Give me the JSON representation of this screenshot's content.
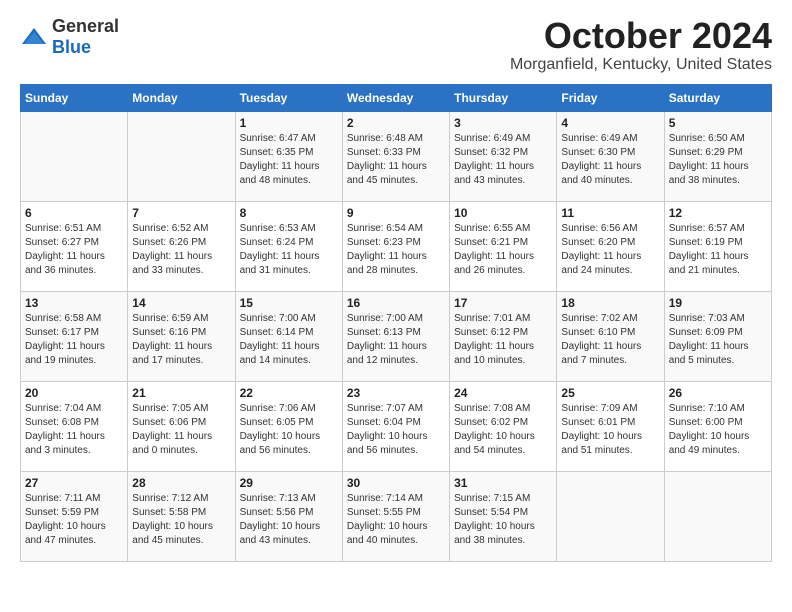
{
  "header": {
    "logo_general": "General",
    "logo_blue": "Blue",
    "month_year": "October 2024",
    "location": "Morganfield, Kentucky, United States"
  },
  "days_of_week": [
    "Sunday",
    "Monday",
    "Tuesday",
    "Wednesday",
    "Thursday",
    "Friday",
    "Saturday"
  ],
  "weeks": [
    [
      {
        "day": "",
        "content": ""
      },
      {
        "day": "",
        "content": ""
      },
      {
        "day": "1",
        "content": "Sunrise: 6:47 AM\nSunset: 6:35 PM\nDaylight: 11 hours and 48 minutes."
      },
      {
        "day": "2",
        "content": "Sunrise: 6:48 AM\nSunset: 6:33 PM\nDaylight: 11 hours and 45 minutes."
      },
      {
        "day": "3",
        "content": "Sunrise: 6:49 AM\nSunset: 6:32 PM\nDaylight: 11 hours and 43 minutes."
      },
      {
        "day": "4",
        "content": "Sunrise: 6:49 AM\nSunset: 6:30 PM\nDaylight: 11 hours and 40 minutes."
      },
      {
        "day": "5",
        "content": "Sunrise: 6:50 AM\nSunset: 6:29 PM\nDaylight: 11 hours and 38 minutes."
      }
    ],
    [
      {
        "day": "6",
        "content": "Sunrise: 6:51 AM\nSunset: 6:27 PM\nDaylight: 11 hours and 36 minutes."
      },
      {
        "day": "7",
        "content": "Sunrise: 6:52 AM\nSunset: 6:26 PM\nDaylight: 11 hours and 33 minutes."
      },
      {
        "day": "8",
        "content": "Sunrise: 6:53 AM\nSunset: 6:24 PM\nDaylight: 11 hours and 31 minutes."
      },
      {
        "day": "9",
        "content": "Sunrise: 6:54 AM\nSunset: 6:23 PM\nDaylight: 11 hours and 28 minutes."
      },
      {
        "day": "10",
        "content": "Sunrise: 6:55 AM\nSunset: 6:21 PM\nDaylight: 11 hours and 26 minutes."
      },
      {
        "day": "11",
        "content": "Sunrise: 6:56 AM\nSunset: 6:20 PM\nDaylight: 11 hours and 24 minutes."
      },
      {
        "day": "12",
        "content": "Sunrise: 6:57 AM\nSunset: 6:19 PM\nDaylight: 11 hours and 21 minutes."
      }
    ],
    [
      {
        "day": "13",
        "content": "Sunrise: 6:58 AM\nSunset: 6:17 PM\nDaylight: 11 hours and 19 minutes."
      },
      {
        "day": "14",
        "content": "Sunrise: 6:59 AM\nSunset: 6:16 PM\nDaylight: 11 hours and 17 minutes."
      },
      {
        "day": "15",
        "content": "Sunrise: 7:00 AM\nSunset: 6:14 PM\nDaylight: 11 hours and 14 minutes."
      },
      {
        "day": "16",
        "content": "Sunrise: 7:00 AM\nSunset: 6:13 PM\nDaylight: 11 hours and 12 minutes."
      },
      {
        "day": "17",
        "content": "Sunrise: 7:01 AM\nSunset: 6:12 PM\nDaylight: 11 hours and 10 minutes."
      },
      {
        "day": "18",
        "content": "Sunrise: 7:02 AM\nSunset: 6:10 PM\nDaylight: 11 hours and 7 minutes."
      },
      {
        "day": "19",
        "content": "Sunrise: 7:03 AM\nSunset: 6:09 PM\nDaylight: 11 hours and 5 minutes."
      }
    ],
    [
      {
        "day": "20",
        "content": "Sunrise: 7:04 AM\nSunset: 6:08 PM\nDaylight: 11 hours and 3 minutes."
      },
      {
        "day": "21",
        "content": "Sunrise: 7:05 AM\nSunset: 6:06 PM\nDaylight: 11 hours and 0 minutes."
      },
      {
        "day": "22",
        "content": "Sunrise: 7:06 AM\nSunset: 6:05 PM\nDaylight: 10 hours and 56 minutes."
      },
      {
        "day": "23",
        "content": "Sunrise: 7:07 AM\nSunset: 6:04 PM\nDaylight: 10 hours and 56 minutes."
      },
      {
        "day": "24",
        "content": "Sunrise: 7:08 AM\nSunset: 6:02 PM\nDaylight: 10 hours and 54 minutes."
      },
      {
        "day": "25",
        "content": "Sunrise: 7:09 AM\nSunset: 6:01 PM\nDaylight: 10 hours and 51 minutes."
      },
      {
        "day": "26",
        "content": "Sunrise: 7:10 AM\nSunset: 6:00 PM\nDaylight: 10 hours and 49 minutes."
      }
    ],
    [
      {
        "day": "27",
        "content": "Sunrise: 7:11 AM\nSunset: 5:59 PM\nDaylight: 10 hours and 47 minutes."
      },
      {
        "day": "28",
        "content": "Sunrise: 7:12 AM\nSunset: 5:58 PM\nDaylight: 10 hours and 45 minutes."
      },
      {
        "day": "29",
        "content": "Sunrise: 7:13 AM\nSunset: 5:56 PM\nDaylight: 10 hours and 43 minutes."
      },
      {
        "day": "30",
        "content": "Sunrise: 7:14 AM\nSunset: 5:55 PM\nDaylight: 10 hours and 40 minutes."
      },
      {
        "day": "31",
        "content": "Sunrise: 7:15 AM\nSunset: 5:54 PM\nDaylight: 10 hours and 38 minutes."
      },
      {
        "day": "",
        "content": ""
      },
      {
        "day": "",
        "content": ""
      }
    ]
  ]
}
